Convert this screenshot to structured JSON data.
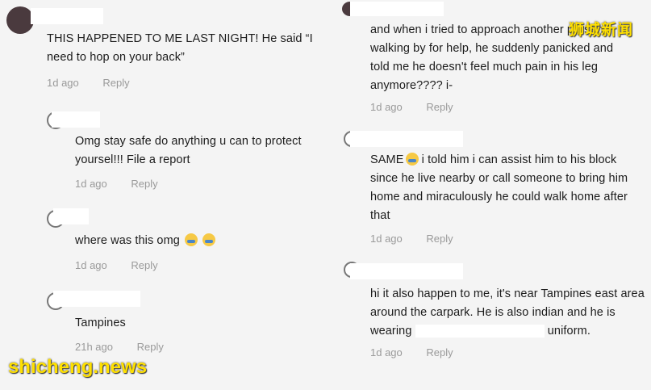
{
  "left_comments": [
    {
      "text": "THIS HAPPENED TO ME LAST NIGHT! He said “I need to hop on your back”",
      "time": "1d ago",
      "reply": "Reply"
    },
    {
      "text": "Omg stay safe do anything u can to protect yoursel!!! File a report",
      "time": "1d ago",
      "reply": "Reply"
    },
    {
      "text": "where was this omg",
      "time": "1d ago",
      "reply": "Reply",
      "emojis": [
        "crying-emoji",
        "crying-emoji"
      ]
    },
    {
      "text": "Tampines",
      "time": "21h ago",
      "reply": "Reply"
    }
  ],
  "right_comments": [
    {
      "text": "and when i tried to approach another person walking by for help, he suddenly panicked and told me he doesn't feel much pain in his leg anymore???? i-",
      "time": "1d ago",
      "reply": "Reply"
    },
    {
      "text_prefix": "SAME",
      "text": " i told him i can assist him to his block since he live nearby or call someone to bring him home and miraculously he could walk home after that",
      "time": "1d ago",
      "reply": "Reply",
      "emoji": "grinning-sweat-emoji"
    },
    {
      "text": "hi it also happen to me, it's near Tampines east area around the carpark. He is also indian and he is wearing",
      "text_suffix": "uniform.",
      "time": "1d ago",
      "reply": "Reply"
    }
  ],
  "watermarks": {
    "top_right": "狮城新闻",
    "bottom_left": "shicheng.news"
  },
  "colors": {
    "background": "#f4f4f4",
    "meta_text": "#9a9a9a",
    "watermark": "#ffe000"
  }
}
